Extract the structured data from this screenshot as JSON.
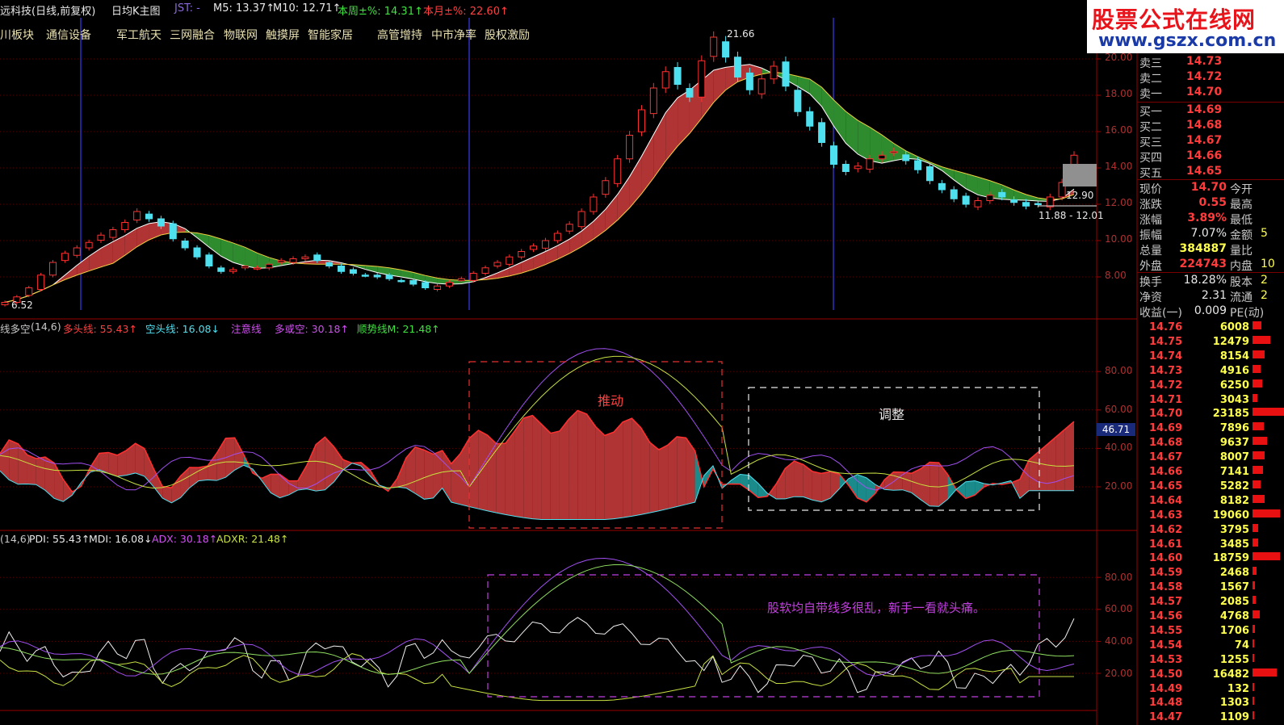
{
  "colors": {
    "up": "#ff3030",
    "down": "#4fe0f0",
    "bull_fill": "#b03434",
    "bear_fill": "#1a8a8a",
    "green_fill": "#2e8b2e",
    "grid": "#7a0000",
    "purple": "#a050f0",
    "yellow_line": "#c8e040",
    "white_line": "#e8e8e8",
    "label": "#b03030"
  },
  "header": {
    "title": "远科技(日线,前复权)",
    "indicator_name": "日均K主图",
    "jst_label": "JST: -",
    "m5": "M5: 13.37↑",
    "m10": "M10: 12.71↑",
    "week_pct": "本周±%: 14.31↑",
    "month_pct": "本月±%: 22.60↑"
  },
  "blocks": [
    "川板块",
    "通信设备",
    "军工航天",
    "三网融合",
    "物联网",
    "触摸屏",
    "智能家居",
    "高管增持",
    "中市净率",
    "股权激励"
  ],
  "logo": {
    "line1": "股票公式在线网",
    "line2": "www.gszx.com.cn"
  },
  "main_chart": {
    "annotations": {
      "high": "21.66",
      "low": "6.52",
      "current_box": "12.90",
      "range": "11.88 - 12.01"
    },
    "y_labels": [
      "20.00",
      "18.00",
      "16.00",
      "14.00",
      "12.00",
      "10.00",
      "8.00"
    ],
    "y_values": [
      20,
      18,
      16,
      14,
      12,
      10,
      8
    ]
  },
  "chart_data": [
    {
      "type": "candlestick",
      "title": "日均K主图",
      "ylim": [
        6,
        22
      ],
      "ohlc_sample_closes": [
        6.6,
        6.9,
        7.4,
        8.1,
        8.8,
        9.3,
        9.6,
        9.9,
        10.3,
        10.6,
        11.0,
        11.6,
        11.2,
        10.8,
        10.1,
        9.6,
        9.1,
        8.6,
        8.3,
        8.4,
        8.6,
        8.5,
        8.7,
        8.9,
        9.0,
        9.1,
        8.9,
        8.6,
        8.3,
        8.2,
        8.1,
        8.0,
        7.9,
        7.8,
        7.6,
        7.4,
        7.5,
        7.7,
        7.9,
        8.2,
        8.5,
        8.8,
        9.1,
        9.4,
        9.7,
        10.0,
        10.4,
        10.9,
        11.6,
        12.4,
        13.3,
        14.5,
        15.8,
        17.2,
        18.4,
        19.3,
        18.6,
        17.9,
        19.9,
        21.2,
        20.1,
        19.0,
        18.3,
        18.9,
        19.6,
        18.5,
        17.1,
        16.3,
        15.4,
        14.2,
        13.8,
        14.1,
        14.5,
        14.7,
        14.9,
        14.4,
        13.9,
        13.3,
        12.8,
        12.3,
        12.0,
        12.2,
        12.5,
        12.4,
        12.1,
        11.9,
        12.0,
        12.4,
        13.2,
        14.7
      ],
      "high": 21.66,
      "low": 6.52
    },
    {
      "type": "area",
      "title": "多空(14,6)",
      "series": [
        {
          "name": "多头线",
          "last": "55.43↑"
        },
        {
          "name": "空头线",
          "last": "16.08↓"
        },
        {
          "name": "注意线 多或空",
          "last": "30.18↑"
        },
        {
          "name": "顺势线M",
          "last": "21.48↑"
        }
      ],
      "ylim": [
        0,
        100
      ],
      "y_labels": [
        "80.00",
        "60.00",
        "40.00",
        "20.00"
      ]
    },
    {
      "type": "line",
      "title": "(14,6)",
      "series": [
        {
          "name": "PDI",
          "last": "55.43↑"
        },
        {
          "name": "MDI",
          "last": "16.08↓"
        },
        {
          "name": "ADX",
          "last": "30.18↑"
        },
        {
          "name": "ADXR",
          "last": "21.48↑"
        }
      ],
      "ylim": [
        0,
        100
      ],
      "y_labels": [
        "80.00",
        "60.00",
        "40.00",
        "20.00"
      ]
    }
  ],
  "ind1": {
    "name": "线多空",
    "params": "(14,6)",
    "s1": "多头线: 55.43↑",
    "s2": "空头线: 16.08↓",
    "s3": "注意线",
    "s4": "多或空: 30.18↑",
    "s5": "顺势线M: 21.48↑",
    "current_value": "46.71",
    "box1_label": "推动",
    "box2_label": "调整",
    "y_labels": [
      "80.00",
      "60.00",
      "40.00",
      "20.00"
    ]
  },
  "ind2": {
    "params": "(14,6)",
    "pdi": "PDI: 55.43↑",
    "mdi": "MDI: 16.08↓",
    "adx": "ADX: 30.18↑",
    "adxr": "ADXR: 21.48↑",
    "note": "股软均自带线多很乱，新手一看就头痛。",
    "y_labels": [
      "80.00",
      "60.00",
      "40.00",
      "20.00"
    ]
  },
  "quote": {
    "asks": [
      {
        "label": "卖三",
        "price": "14.73"
      },
      {
        "label": "卖二",
        "price": "14.72"
      },
      {
        "label": "卖一",
        "price": "14.70"
      }
    ],
    "bids": [
      {
        "label": "买一",
        "price": "14.69"
      },
      {
        "label": "买二",
        "price": "14.68"
      },
      {
        "label": "买三",
        "price": "14.67"
      },
      {
        "label": "买四",
        "price": "14.66"
      },
      {
        "label": "买五",
        "price": "14.65"
      }
    ],
    "stats": [
      {
        "l1": "现价",
        "v1": "14.70",
        "l2": "今开",
        "v2": ""
      },
      {
        "l1": "涨跌",
        "v1": "0.55",
        "l2": "最高",
        "v2": ""
      },
      {
        "l1": "涨幅",
        "v1": "3.89%",
        "l2": "最低",
        "v2": ""
      },
      {
        "l1": "振幅",
        "v1": "7.07%",
        "l2": "金额",
        "v2": "5"
      },
      {
        "l1": "总量",
        "v1": "384887",
        "l2": "量比",
        "v2": ""
      },
      {
        "l1": "外盘",
        "v1": "224743",
        "l2": "内盘",
        "v2": "10"
      },
      {
        "l1": "换手",
        "v1": "18.28%",
        "l2": "股本",
        "v2": "2"
      },
      {
        "l1": "净资",
        "v1": "2.31",
        "l2": "流通",
        "v2": "2"
      },
      {
        "l1": "收益(一)",
        "v1": "0.009",
        "l2": "PE(动)",
        "v2": ""
      }
    ]
  },
  "order_book": [
    {
      "price": "14.76",
      "vol": "6008",
      "bar": 0.28
    },
    {
      "price": "14.75",
      "vol": "12479",
      "bar": 0.55
    },
    {
      "price": "14.74",
      "vol": "8154",
      "bar": 0.38
    },
    {
      "price": "14.73",
      "vol": "4916",
      "bar": 0.24
    },
    {
      "price": "14.72",
      "vol": "6250",
      "bar": 0.29
    },
    {
      "price": "14.71",
      "vol": "3043",
      "bar": 0.15
    },
    {
      "price": "14.70",
      "vol": "23185",
      "bar": 1.0
    },
    {
      "price": "14.69",
      "vol": "7896",
      "bar": 0.36
    },
    {
      "price": "14.68",
      "vol": "9637",
      "bar": 0.44
    },
    {
      "price": "14.67",
      "vol": "8007",
      "bar": 0.37
    },
    {
      "price": "14.66",
      "vol": "7141",
      "bar": 0.33
    },
    {
      "price": "14.65",
      "vol": "5282",
      "bar": 0.25
    },
    {
      "price": "14.64",
      "vol": "8182",
      "bar": 0.38
    },
    {
      "price": "14.63",
      "vol": "19060",
      "bar": 0.85
    },
    {
      "price": "14.62",
      "vol": "3795",
      "bar": 0.18
    },
    {
      "price": "14.61",
      "vol": "3485",
      "bar": 0.17
    },
    {
      "price": "14.60",
      "vol": "18759",
      "bar": 0.84
    },
    {
      "price": "14.59",
      "vol": "2468",
      "bar": 0.12
    },
    {
      "price": "14.58",
      "vol": "1567",
      "bar": 0.08
    },
    {
      "price": "14.57",
      "vol": "2085",
      "bar": 0.1
    },
    {
      "price": "14.56",
      "vol": "4768",
      "bar": 0.22
    },
    {
      "price": "14.55",
      "vol": "1706",
      "bar": 0.08
    },
    {
      "price": "14.54",
      "vol": "74",
      "bar": 0.01
    },
    {
      "price": "14.53",
      "vol": "1255",
      "bar": 0.06
    },
    {
      "price": "14.50",
      "vol": "16482",
      "bar": 0.74
    },
    {
      "price": "14.49",
      "vol": "132",
      "bar": 0.01
    },
    {
      "price": "14.48",
      "vol": "1303",
      "bar": 0.06
    },
    {
      "price": "14.47",
      "vol": "1109",
      "bar": 0.05
    }
  ]
}
